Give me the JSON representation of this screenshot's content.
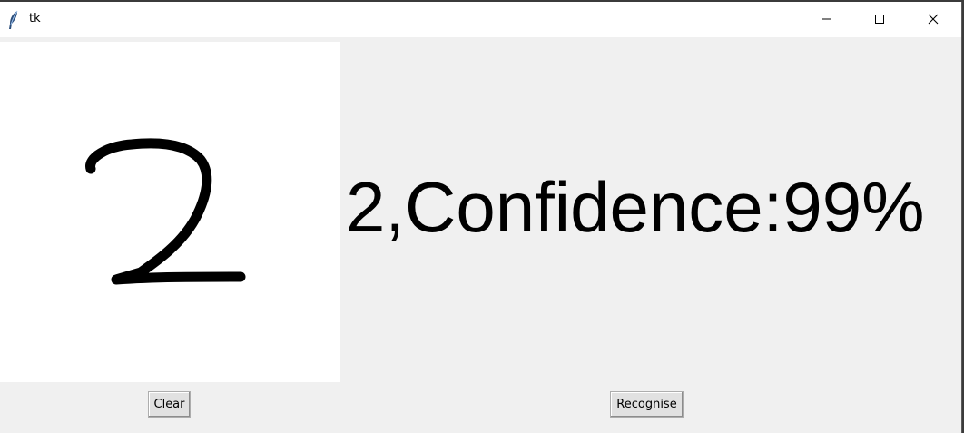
{
  "window": {
    "title": "tk",
    "app_icon": "tk-feather-icon",
    "controls": {
      "minimize_icon": "minimize-icon",
      "maximize_icon": "maximize-icon",
      "close_icon": "close-icon"
    }
  },
  "canvas": {
    "drawn_digit_icon": "handwritten-digit-2"
  },
  "result": {
    "text": "2,Confidence:99%"
  },
  "buttons": {
    "clear_label": "Clear",
    "recognise_label": "Recognise"
  },
  "colors": {
    "background": "#f0f0f0",
    "canvas": "#ffffff",
    "ink": "#000000"
  }
}
